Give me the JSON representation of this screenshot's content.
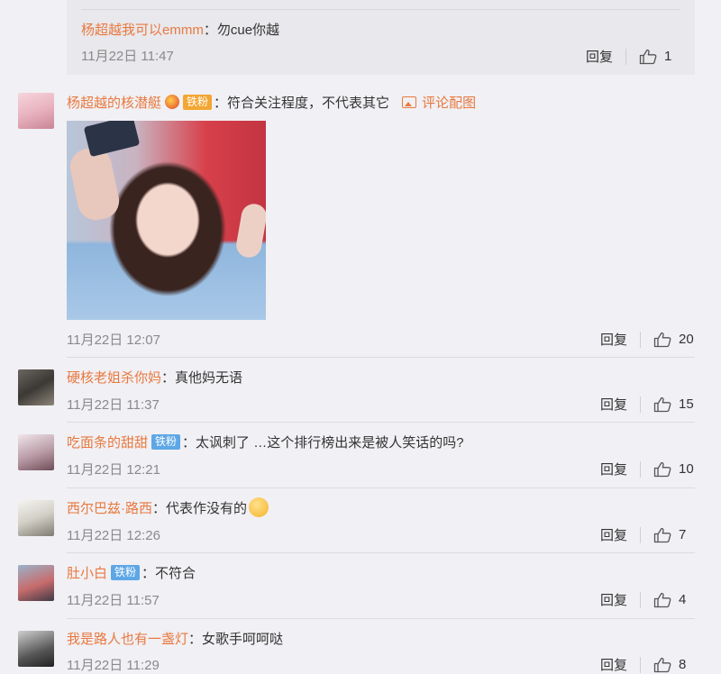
{
  "reply": {
    "name": "杨超越我可以emmm",
    "text": "勿cue你越",
    "time": "11月22日 11:47",
    "reply_label": "回复",
    "likes": "1"
  },
  "comments": [
    {
      "name": "杨超越的核潜艇",
      "badge": "铁粉",
      "text": "符合关注程度，不代表其它",
      "attach": "评论配图",
      "time": "11月22日 12:07",
      "reply_label": "回复",
      "likes": "20"
    },
    {
      "name": "硬核老姐杀你妈",
      "text": "真他妈无语",
      "time": "11月22日 11:37",
      "reply_label": "回复",
      "likes": "15"
    },
    {
      "name": "吃面条的甜甜",
      "badge": "铁粉",
      "text": "太讽刺了 …这个排行榜出来是被人笑话的吗?",
      "time": "11月22日 12:21",
      "reply_label": "回复",
      "likes": "10"
    },
    {
      "name": "西尔巴兹·路西",
      "text": "代表作没有的",
      "time": "11月22日 12:26",
      "reply_label": "回复",
      "likes": "7"
    },
    {
      "name": "肚小白",
      "badge": "铁粉",
      "text": "不符合",
      "time": "11月22日 11:57",
      "reply_label": "回复",
      "likes": "4"
    },
    {
      "name": "我是路人也有一盏灯",
      "text": "女歌手呵呵哒",
      "time": "11月22日 11:29",
      "reply_label": "回复",
      "likes": "8"
    }
  ],
  "colors": {
    "name": "#e8793f",
    "badge": "#5ea7e6",
    "background": "#f1f0f4"
  },
  "icons": {
    "like": "thumbs-up-icon",
    "attach": "image-icon",
    "emoji": "smiling-face-icon"
  }
}
